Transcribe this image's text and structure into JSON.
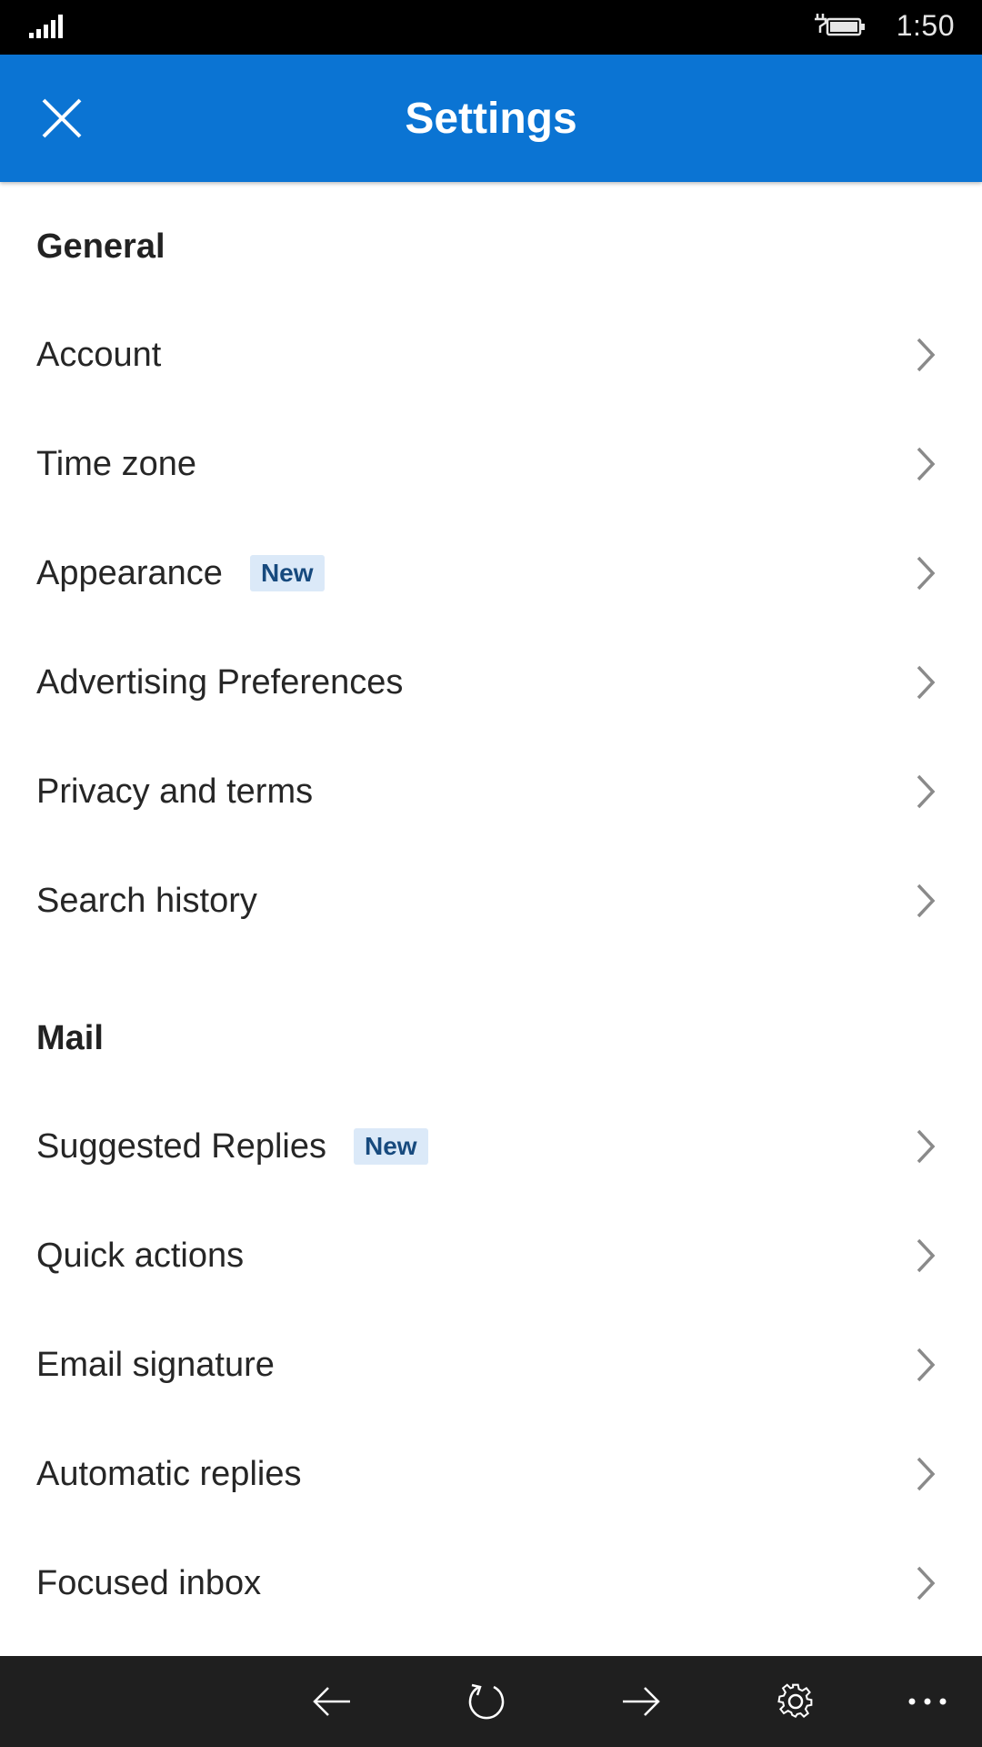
{
  "status_bar": {
    "time": "1:50",
    "icons": [
      "signal-icon",
      "battery-charging-icon"
    ]
  },
  "header": {
    "title": "Settings",
    "close_icon": "close-icon",
    "background": "#0b74d3"
  },
  "sections": {
    "general": {
      "title": "General",
      "items": [
        {
          "label": "Account"
        },
        {
          "label": "Time zone"
        },
        {
          "label": "Appearance",
          "badge": "New"
        },
        {
          "label": "Advertising Preferences"
        },
        {
          "label": "Privacy and terms"
        },
        {
          "label": "Search history"
        }
      ]
    },
    "mail": {
      "title": "Mail",
      "items": [
        {
          "label": "Suggested Replies",
          "badge": "New"
        },
        {
          "label": "Quick actions"
        },
        {
          "label": "Email signature"
        },
        {
          "label": "Automatic replies"
        },
        {
          "label": "Focused inbox"
        }
      ]
    }
  },
  "bottom_bar": {
    "icons": [
      "back-arrow-icon",
      "refresh-icon",
      "forward-arrow-icon",
      "gear-icon",
      "more-icon"
    ]
  },
  "colors": {
    "accent": "#0b74d3",
    "badge_bg": "#dbe9f8",
    "badge_text": "#174a7e",
    "chevron": "#8a8a8a"
  }
}
